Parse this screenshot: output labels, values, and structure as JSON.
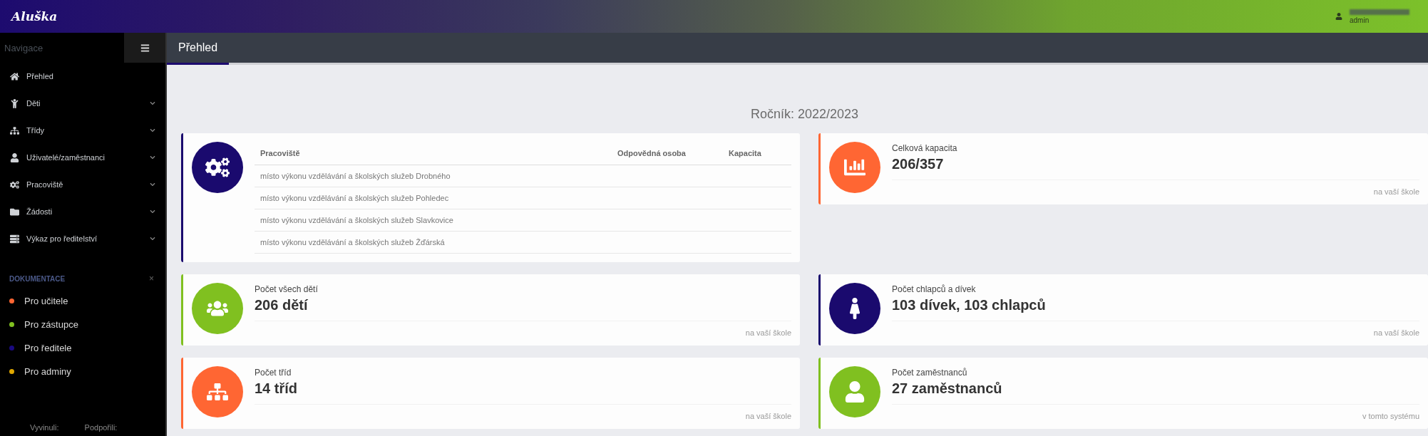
{
  "topbar": {
    "logo": "Aluška",
    "user": {
      "role": "admin"
    }
  },
  "sidebar": {
    "header": "Navigace",
    "items": [
      {
        "label": "Přehled",
        "expandable": false
      },
      {
        "label": "Děti",
        "expandable": true
      },
      {
        "label": "Třídy",
        "expandable": true
      },
      {
        "label": "Uživatelé/zaměstnanci",
        "expandable": true
      },
      {
        "label": "Pracoviště",
        "expandable": true
      },
      {
        "label": "Žádosti",
        "expandable": true
      },
      {
        "label": "Výkaz pro ředitelství",
        "expandable": true
      }
    ],
    "docs": {
      "title": "DOKUMENTACE",
      "close": "×",
      "items": [
        {
          "label": "Pro učitele",
          "color": "#ff6633"
        },
        {
          "label": "Pro zástupce",
          "color": "#80c020"
        },
        {
          "label": "Pro ředitele",
          "color": "#1a0a80"
        },
        {
          "label": "Pro adminy",
          "color": "#e0a800"
        }
      ]
    },
    "footer": [
      "Vyvinuli:",
      "Podpořili:"
    ]
  },
  "tabs": [
    {
      "label": "Přehled",
      "selected": true
    }
  ],
  "year_title": "Ročník: 2022/2023",
  "workplaces": {
    "color": "#1a0a6e",
    "columns": [
      "Pracoviště",
      "Odpovědná osoba",
      "Kapacita"
    ],
    "rows": [
      "místo výkonu vzdělávání a školských služeb Drobného",
      "místo výkonu vzdělávání a školských služeb Pohledec",
      "místo výkonu vzdělávání a školských služeb Slavkovice",
      "místo výkonu vzdělávání a školských služeb Žďárská"
    ]
  },
  "stats": [
    {
      "label": "Celková kapacita",
      "value": "206/357",
      "note": "na vaší škole",
      "color": "#ff6633"
    },
    {
      "label": "Počet všech dětí",
      "value": "206 dětí",
      "note": "na vaší škole",
      "color": "#80c020"
    },
    {
      "label": "Počet chlapců a dívek",
      "value": "103 dívek, 103 chlapců",
      "note": "na vaší škole",
      "color": "#1a0a6e"
    },
    {
      "label": "Počet tříd",
      "value": "14 tříd",
      "note": "na vaší škole",
      "color": "#ff6633"
    },
    {
      "label": "Počet zaměstnanců",
      "value": "27 zaměstnanců",
      "note": "v tomto systému",
      "color": "#80c020"
    }
  ]
}
